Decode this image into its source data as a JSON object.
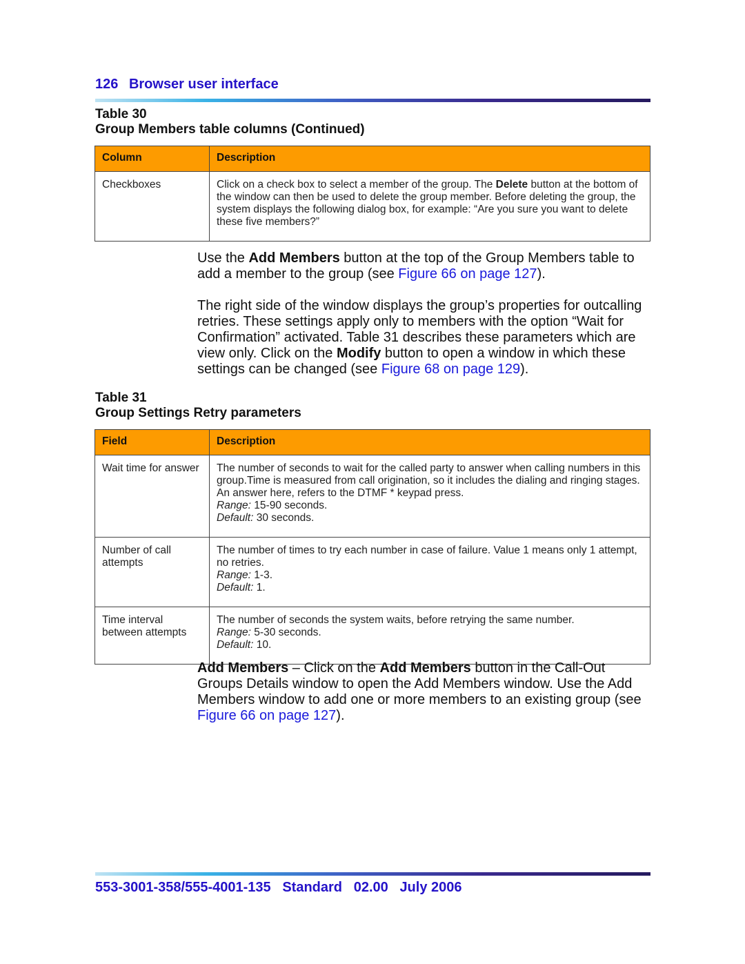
{
  "header": {
    "page_number": "126",
    "section_title": "Browser user interface"
  },
  "table30": {
    "label": "Table 30",
    "title": "Group Members table columns (Continued)",
    "columns": [
      "Column",
      "Description"
    ],
    "rows": [
      {
        "column": "Checkboxes",
        "desc_part1": "Click on a check box to select a member of the group. The ",
        "desc_bold": "Delete",
        "desc_part2": " button at the bottom of the window can then be used to delete the group member. Before deleting the group, the system displays the following dialog box, for example: “Are you sure you want to delete these five members?”"
      }
    ]
  },
  "paragraph1": {
    "part1": "Use the ",
    "bold1": "Add Members",
    "part2": " button at the top of the Group Members table to add a member to the group (see ",
    "link": "Figure 66 on page 127",
    "part3": ")."
  },
  "paragraph2": {
    "part1": "The right side of the window displays the group’s properties for outcalling retries. These settings apply only to members with the option “Wait for Confirmation” activated. Table 31 describes these parameters which are view only. Click on the ",
    "bold1": "Modify",
    "part2": " button to open a window in which these settings can be changed (see ",
    "link": "Figure 68 on page 129",
    "part3": ")."
  },
  "table31": {
    "label": "Table 31",
    "title": "Group Settings Retry parameters",
    "columns": [
      "Field",
      "Description"
    ],
    "rows": [
      {
        "field": "Wait time for answer",
        "description": "The number of seconds to wait for the called party to answer when calling numbers in this group.Time is measured from call origination, so it includes the dialing and ringing stages. An answer here, refers to the DTMF * keypad press.",
        "range_label": "Range:",
        "range": " 15-90 seconds.",
        "default_label": "Default:",
        "default": " 30 seconds."
      },
      {
        "field": "Number of call attempts",
        "description": "The number of times to try each number in case of failure. Value 1 means only 1 attempt, no retries.",
        "range_label": "Range:",
        "range": " 1-3.",
        "default_label": "Default:",
        "default": " 1."
      },
      {
        "field": "Time interval between attempts",
        "description": "The number of seconds the system waits, before retrying the same number.",
        "range_label": "Range:",
        "range": " 5-30 seconds.",
        "default_label": "Default:",
        "default": " 10."
      }
    ]
  },
  "paragraph3": {
    "bold1": "Add Members",
    "part1": " – Click on the ",
    "bold2": "Add Members",
    "part2": " button in the Call-Out Groups Details window to open the Add Members window. Use the Add Members window to add one or more members to an existing group (see ",
    "link": "Figure 66 on page 127",
    "part3": ")."
  },
  "footer": {
    "doc_number": "553-3001-358/555-4001-135",
    "status": "Standard",
    "version": "02.00",
    "date": "July 2006"
  },
  "colors": {
    "header_blue": "#2412c8",
    "link_blue": "#1a1adb",
    "table_header_orange": "#fd9b00"
  }
}
